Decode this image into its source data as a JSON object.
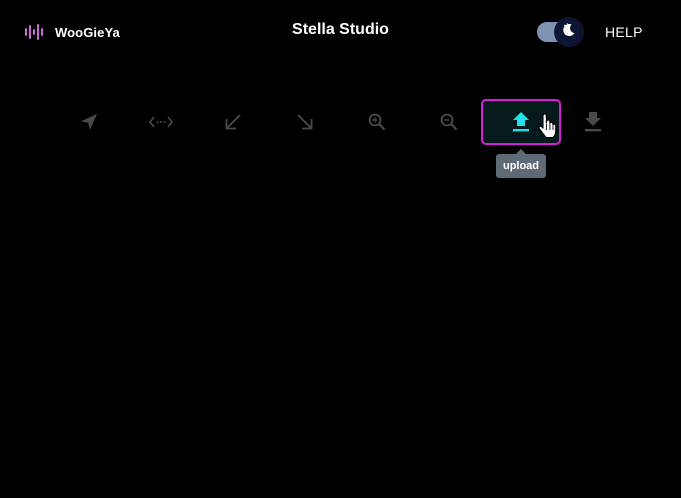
{
  "header": {
    "brand_name": "WooGieYa",
    "title": "Stella Studio",
    "help_label": "HELP",
    "theme_toggle_state": "dark"
  },
  "toolbar": {
    "tools": [
      {
        "name": "navigate",
        "icon": "navigation-arrow-icon"
      },
      {
        "name": "code",
        "icon": "code-icon"
      },
      {
        "name": "arrow-down-left",
        "icon": "arrow-down-left-icon"
      },
      {
        "name": "arrow-down-right",
        "icon": "arrow-down-right-icon"
      },
      {
        "name": "zoom-in",
        "icon": "zoom-in-icon"
      },
      {
        "name": "zoom-out",
        "icon": "zoom-out-icon"
      },
      {
        "name": "upload",
        "icon": "upload-icon",
        "active": true
      },
      {
        "name": "download",
        "icon": "download-icon"
      }
    ],
    "tooltip": "upload"
  },
  "colors": {
    "background": "#000000",
    "active_border": "#d21fd8",
    "active_icon": "#22e0ea",
    "inactive_icon": "#4a4a4a",
    "brand_logo": "#c76ad2",
    "toggle_track": "#7f93b4",
    "toggle_knob": "#0e1633",
    "tooltip_bg": "#5e6b74"
  }
}
